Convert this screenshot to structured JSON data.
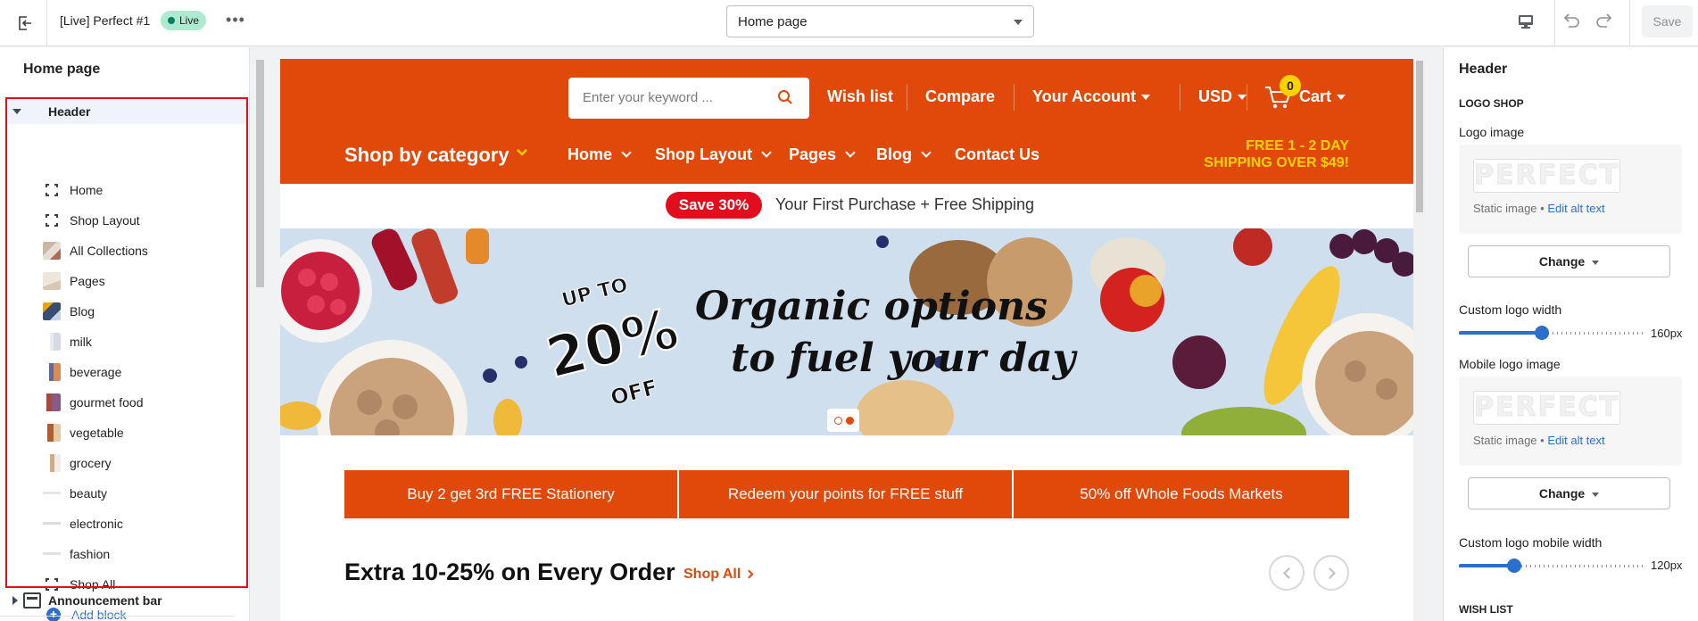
{
  "topbar": {
    "theme_name": "[Live] Perfect #1",
    "live_badge": "Live",
    "more_label": "•••",
    "page_select": "Home page",
    "save_label": "Save"
  },
  "sidebar": {
    "title": "Home page",
    "section": "Header",
    "blocks": [
      {
        "label": "Home",
        "icon": "frame-icon"
      },
      {
        "label": "Shop Layout",
        "icon": "frame-icon"
      },
      {
        "label": "All Collections",
        "icon": "thumbnail"
      },
      {
        "label": "Pages",
        "icon": "thumbnail"
      },
      {
        "label": "Blog",
        "icon": "thumbnail"
      },
      {
        "label": "milk",
        "icon": "thumbnail"
      },
      {
        "label": "beverage",
        "icon": "thumbnail"
      },
      {
        "label": "gourmet food",
        "icon": "thumbnail"
      },
      {
        "label": "vegetable",
        "icon": "thumbnail"
      },
      {
        "label": "grocery",
        "icon": "thumbnail"
      },
      {
        "label": "beauty",
        "icon": "thumbnail"
      },
      {
        "label": "electronic",
        "icon": "thumbnail"
      },
      {
        "label": "fashion",
        "icon": "thumbnail"
      },
      {
        "label": "Shop All",
        "icon": "frame-icon"
      }
    ],
    "add_block": "Add block",
    "next_section": "Announcement bar"
  },
  "store": {
    "search_placeholder": "Enter your keyword ...",
    "wishlist": "Wish list",
    "compare": "Compare",
    "account": "Your Account",
    "currency": "USD",
    "cart_count": "0",
    "cart": "Cart",
    "shop_by_category": "Shop by category",
    "menu": [
      "Home",
      "Shop Layout",
      "Pages",
      "Blog",
      "Contact Us"
    ],
    "free_line1": "FREE 1 - 2 DAY",
    "free_line2": "SHIPPING OVER $49!",
    "save_pill": "Save 30%",
    "strip_text": "Your First Purchase + Free Shipping",
    "banner": {
      "badge_top": "UP TO",
      "badge_pct": "20%",
      "badge_off": "OFF",
      "headline_1": "Organic options",
      "headline_2": "to fuel your day"
    },
    "promos": [
      "Buy 2 get 3rd FREE Stationery",
      "Redeem your points for FREE stuff",
      "50% off Whole Foods Markets"
    ],
    "section_title": "Extra 10-25% on Every Order",
    "shop_all": "Shop All"
  },
  "settings": {
    "title": "Header",
    "logo_shop": "LOGO SHOP",
    "logo_image": "Logo image",
    "logo_text": "PERFECT",
    "static_image": "Static image •",
    "edit_alt": "Edit alt text",
    "change": "Change",
    "custom_logo_width": "Custom logo width",
    "logo_width_value": "160px",
    "logo_width_level": 0.45,
    "mobile_logo_image": "Mobile logo image",
    "custom_logo_mobile_width": "Custom logo mobile width",
    "mobile_width_value": "120px",
    "mobile_width_level": 0.3,
    "wish_list": "WISH LIST"
  },
  "colors": {
    "brand_orange": "#e1490a",
    "accent_yellow": "#ffd200",
    "highlight_red": "#e20e1e",
    "link_blue": "#2c6ecb"
  }
}
